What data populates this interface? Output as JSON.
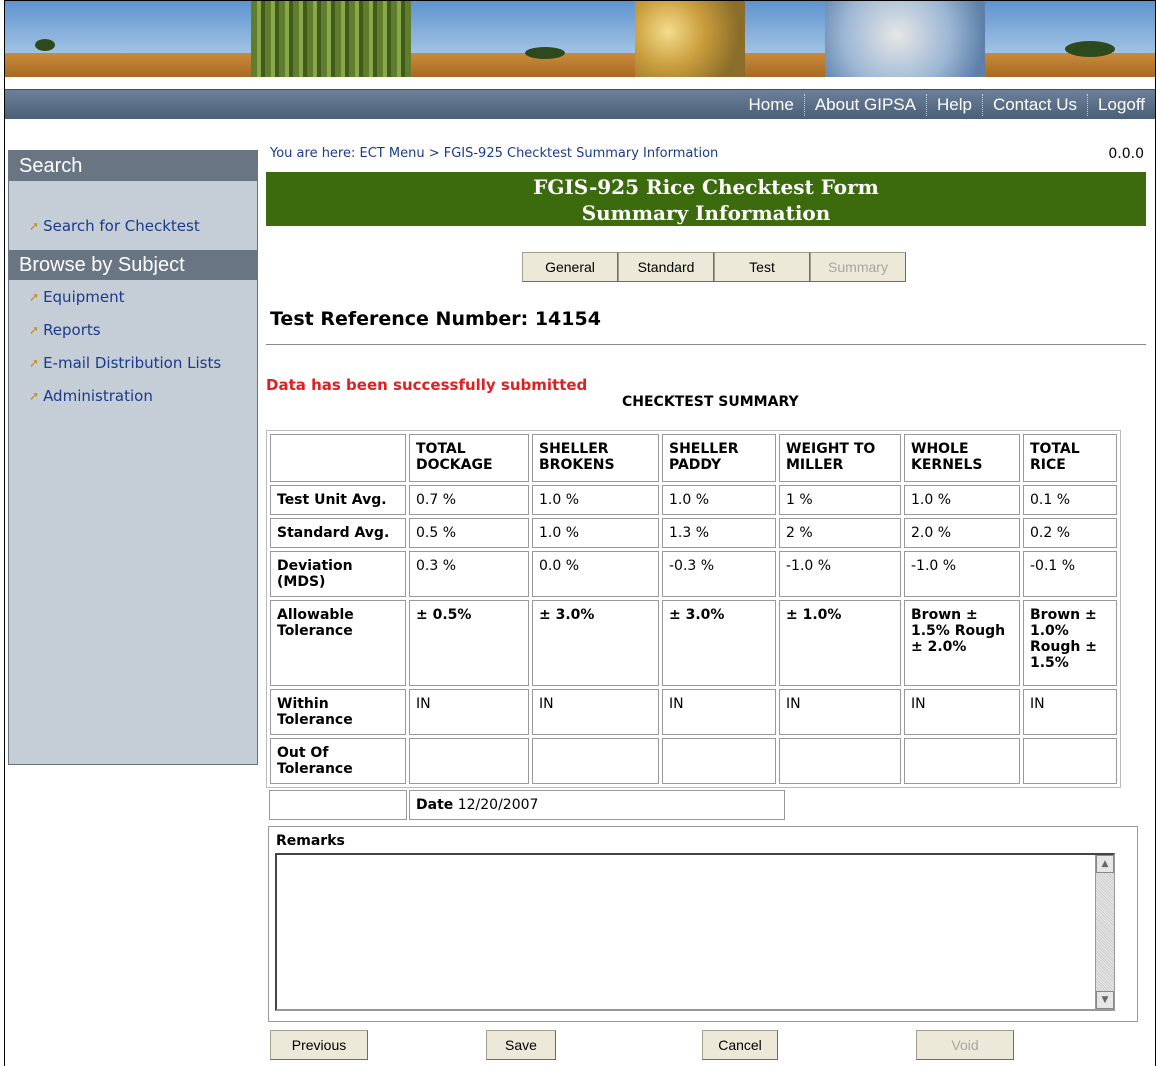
{
  "nav": {
    "items": [
      {
        "label": "Home"
      },
      {
        "label": "About GIPSA"
      },
      {
        "label": "Help"
      },
      {
        "label": "Contact Us"
      },
      {
        "label": "Logoff"
      }
    ]
  },
  "sidebar": {
    "search_heading": "Search",
    "search_link": "Search for Checktest",
    "browse_heading": "Browse by Subject",
    "links": [
      {
        "label": "Equipment"
      },
      {
        "label": "Reports"
      },
      {
        "label": "E-mail Distribution Lists"
      },
      {
        "label": "Administration"
      }
    ]
  },
  "breadcrumb": "You are here: ECT Menu > FGIS-925 Checktest Summary Information",
  "version": "0.0.0",
  "title_line1": "FGIS-925 Rice Checktest Form",
  "title_line2": "Summary Information",
  "tabs": [
    {
      "label": "General"
    },
    {
      "label": "Standard"
    },
    {
      "label": "Test"
    },
    {
      "label": "Summary"
    }
  ],
  "reference_label": "Test Reference Number: 14154",
  "success_message": "Data has been successfully submitted",
  "summary_title": "CHECKTEST SUMMARY",
  "table": {
    "columns": [
      {
        "line1": "TOTAL",
        "line2": "DOCKAGE"
      },
      {
        "line1": "SHELLER",
        "line2": "BROKENS"
      },
      {
        "line1": "SHELLER",
        "line2": "PADDY"
      },
      {
        "line1": "WEIGHT TO",
        "line2": "MILLER"
      },
      {
        "line1": "WHOLE",
        "line2": "KERNELS"
      },
      {
        "line1": "TOTAL",
        "line2": "RICE"
      }
    ],
    "rows": [
      {
        "label": "Test Unit Avg.",
        "values": [
          "0.7 %",
          "1.0 %",
          "1.0 %",
          "1 %",
          "1.0 %",
          "0.1 %"
        ]
      },
      {
        "label": "Standard Avg.",
        "values": [
          "0.5 %",
          "1.0 %",
          "1.3 %",
          "2 %",
          "2.0 %",
          "0.2 %"
        ]
      },
      {
        "label": "Deviation (MDS)",
        "values": [
          "0.3 %",
          "0.0 %",
          "-0.3 %",
          "-1.0 %",
          "-1.0 %",
          "-0.1 %"
        ]
      },
      {
        "label": "Allowable Tolerance",
        "values": [
          "± 0.5%",
          "± 3.0%",
          "± 3.0%",
          "± 1.0%",
          "Brown ± 1.5% Rough ± 2.0%",
          "Brown ± 1.0% Rough ± 1.5%"
        ]
      },
      {
        "label": "Within Tolerance",
        "values": [
          "IN",
          "IN",
          "IN",
          "IN",
          "IN",
          "IN"
        ]
      },
      {
        "label": "Out Of Tolerance",
        "values": [
          "",
          "",
          "",
          "",
          "",
          ""
        ]
      }
    ]
  },
  "date_label": "Date",
  "date_value": "12/20/2007",
  "remarks_label": "Remarks",
  "remarks_value": "",
  "buttons": {
    "previous": "Previous",
    "save": "Save",
    "cancel": "Cancel",
    "void": "Void"
  }
}
